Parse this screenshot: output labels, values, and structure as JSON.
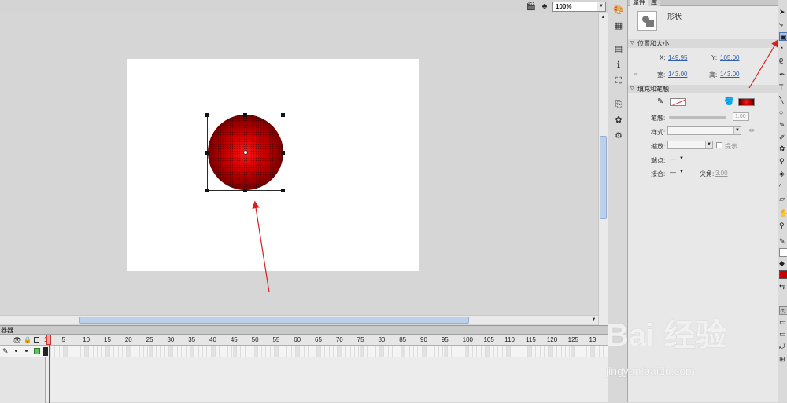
{
  "stage": {
    "zoom": "100%"
  },
  "timeline": {
    "panel_title": "器器",
    "frame_numbers": [
      "1",
      "5",
      "10",
      "15",
      "20",
      "25",
      "30",
      "35",
      "40",
      "45",
      "50",
      "55",
      "60",
      "65",
      "70",
      "75",
      "80",
      "85",
      "90",
      "95",
      "100",
      "105",
      "110",
      "115",
      "120",
      "125",
      "13"
    ],
    "current_frame": 1
  },
  "properties": {
    "tabs": [
      "属性",
      "库"
    ],
    "object_type": "形状",
    "position_size": {
      "header": "位置和大小",
      "x_label": "X:",
      "x_value": "149.95",
      "y_label": "Y:",
      "y_value": "105.00",
      "w_label": "宽:",
      "w_value": "143.00",
      "h_label": "高:",
      "h_value": "143.00"
    },
    "fill_stroke": {
      "header": "填充和笔触",
      "stroke_label": "笔触:",
      "stroke_value": "1.00",
      "style_label": "样式:",
      "scale_label": "缩放:",
      "hint_label": "提示",
      "cap_label": "端点:",
      "cap_value": "—",
      "join_label": "接合:",
      "join_value": "—",
      "miter_label": "尖角:",
      "miter_value": "3.00",
      "fill_color": "#cc0000",
      "stroke_color": "#ffffff"
    }
  },
  "watermark": {
    "logo": "Bai 经验",
    "url": "jingyan.baidu.com"
  },
  "annotation": {
    "arrow_color": "#d42020"
  }
}
